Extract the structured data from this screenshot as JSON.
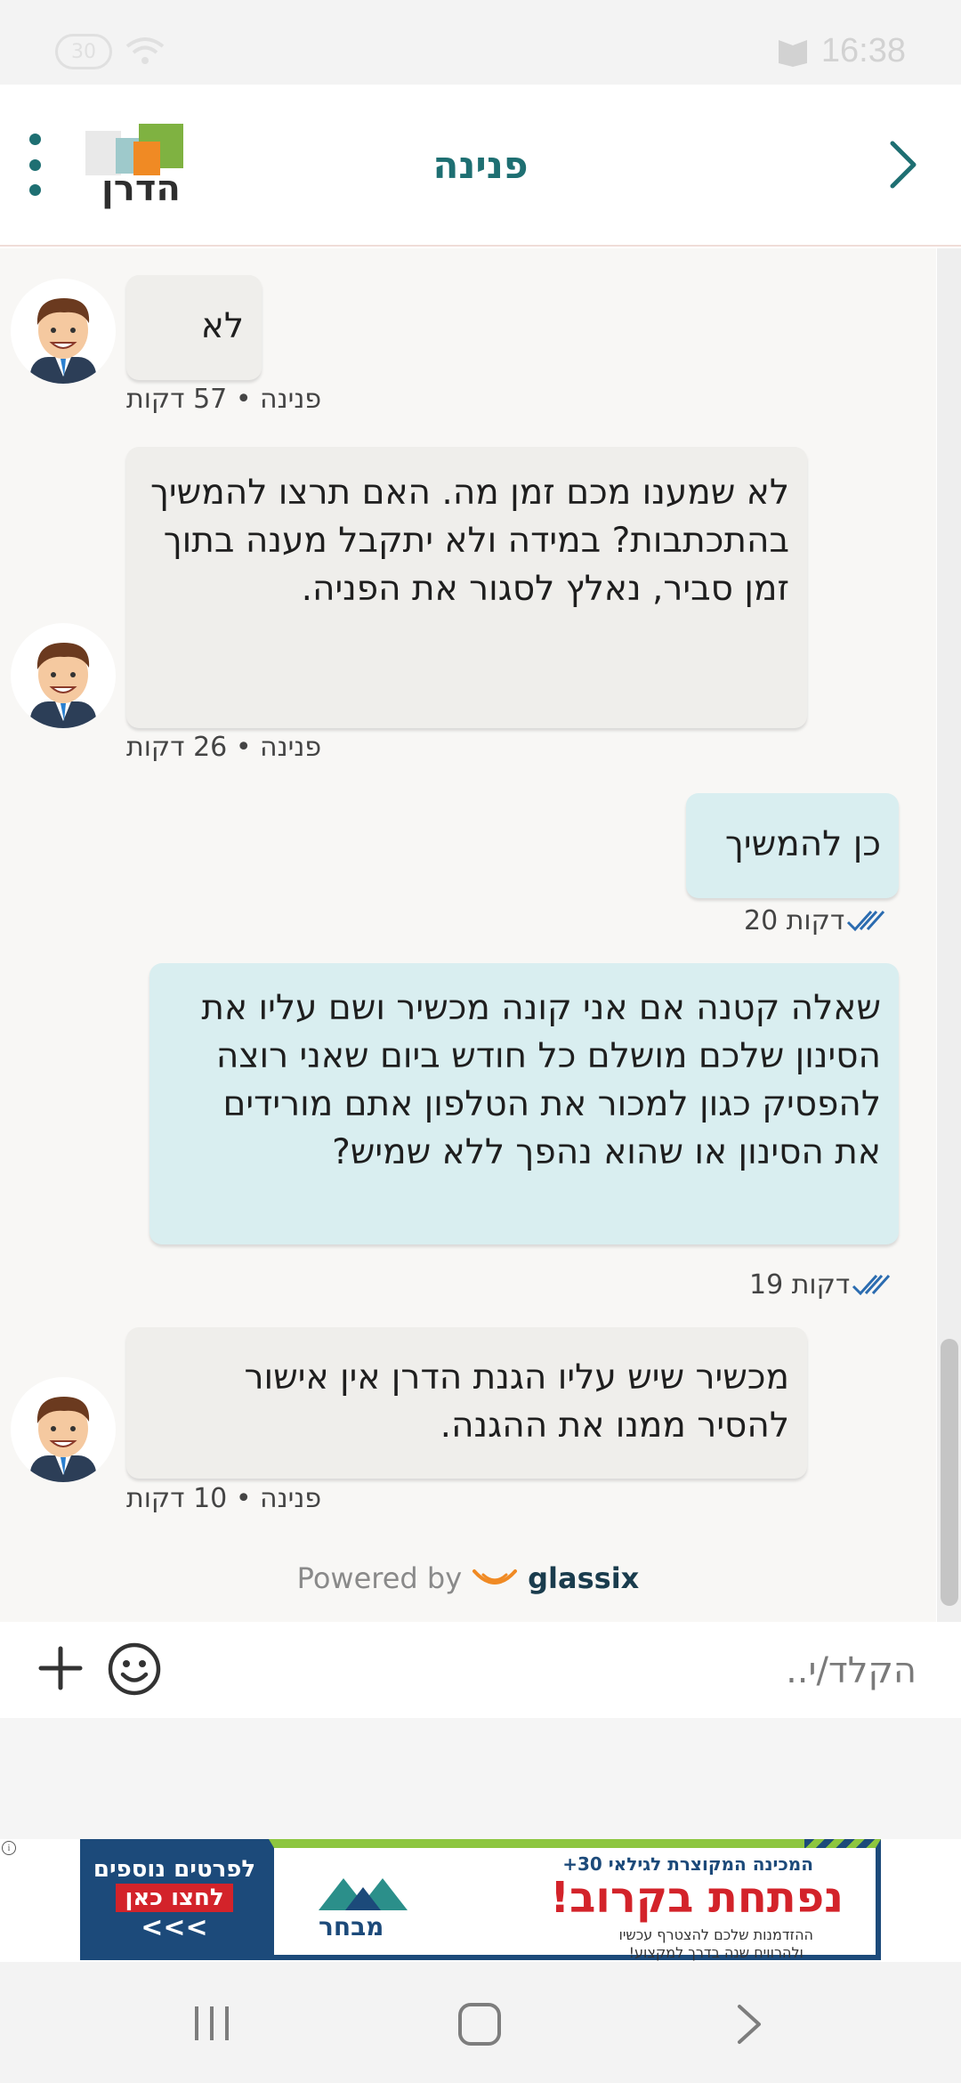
{
  "status_bar": {
    "time": "16:38",
    "left_badge": "30",
    "right_icon": "notification-icon"
  },
  "header": {
    "title": "פנינה",
    "logo_text": "הדרן",
    "back_icon": "chevron-right-icon",
    "menu_icon": "more-vertical-icon"
  },
  "messages": [
    {
      "sender": "agent",
      "text": "לא",
      "meta": "פנינה • 57 דקות"
    },
    {
      "sender": "agent",
      "text": "לא שמענו מכם זמן מה. האם תרצו להמשיך בהתכתבות? במידה ולא יתקבל מענה בתוך זמן סביר, נאלץ לסגור את הפניה.",
      "meta": "פנינה • 26 דקות"
    },
    {
      "sender": "user",
      "text": "כן להמשיך",
      "meta": "20 דקות"
    },
    {
      "sender": "user",
      "text": "שאלה קטנה אם אני קונה מכשיר ושם עליו את הסינון שלכם מושלם כל חודש ביום שאני רוצה להפסיק כגון למכור את הטלפון אתם מורידים את הסינון או שהוא נהפך ללא שמיש?",
      "meta": "19 דקות"
    },
    {
      "sender": "agent",
      "text": "מכשיר שיש עליו הגנת הדרן אין אישור להסיר ממנו את ההגנה.",
      "meta": "פנינה • 10 דקות"
    }
  ],
  "powered_by": {
    "label": "Powered by",
    "brand": "glassix"
  },
  "composer": {
    "placeholder": "הקלד/י..",
    "emoji_icon": "smiley-icon",
    "attach_icon": "plus-icon"
  },
  "ad": {
    "left_title": "לפרטים נוספים",
    "left_cta": "לחצו כאן",
    "left_arrows": "<<<",
    "line1": "המכינה המקוצרת לגילאי 30+",
    "line2": "נפתחת בקרוב!",
    "line3a": "ההזדמנות שלכם להצטרף עכשיו",
    "line3b": "ולהרוויח שנה בדרך למקצוע!",
    "logo_text": "מבחר"
  },
  "nav": {
    "recent_icon": "recent-apps-icon",
    "home_icon": "home-icon",
    "back_icon": "back-icon"
  },
  "colors": {
    "accent": "#1e6f72",
    "agent_bubble": "#efeeeb",
    "user_bubble": "#d9eef0",
    "chat_bg": "#f8f7f5",
    "read_check": "#2b6cb0"
  }
}
